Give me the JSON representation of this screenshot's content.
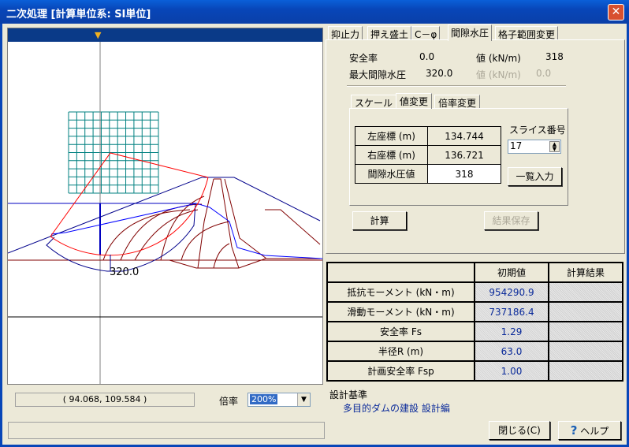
{
  "window": {
    "title": "二次処理 [計算単位系: SI単位]",
    "close_icon": "close-icon"
  },
  "canvas": {
    "slip_label": "320.0",
    "coords": "( 94.068, 109.584 )",
    "zoom_label": "倍率",
    "zoom_value": "200%"
  },
  "tabs": [
    "抑止力",
    "押え盛土",
    "C－φ",
    "間隙水圧",
    "格子範囲変更"
  ],
  "active_tab": 3,
  "summary": {
    "safety_label": "安全率",
    "safety_value": "0.0",
    "value_label": "値 (kN/m)",
    "value": "318",
    "max_label": "最大間隙水圧",
    "max_value": "320.0",
    "value2_label": "値 (kN/m)",
    "value2": "0.0"
  },
  "subtabs": [
    "スケール",
    "値変更",
    "倍率変更"
  ],
  "subgrid": [
    {
      "label": "左座標 (m)",
      "value": "134.744"
    },
    {
      "label": "右座標 (m)",
      "value": "136.721"
    },
    {
      "label": "間隙水圧値",
      "value": "318"
    }
  ],
  "slice": {
    "label": "スライス番号",
    "value": "17",
    "list_button": "一覧入力"
  },
  "buttons": {
    "calc": "計算",
    "save": "結果保存",
    "close": "閉じる(C)",
    "help": "ヘルプ"
  },
  "results": {
    "headers": [
      "",
      "初期値",
      "計算結果"
    ],
    "rows": [
      {
        "label": "抵抗モーメント (kN・m)",
        "initial": "954290.9",
        "result": ""
      },
      {
        "label": "滑動モーメント (kN・m)",
        "initial": "737186.4",
        "result": ""
      },
      {
        "label": "安全率 Fs",
        "initial": "1.29",
        "result": ""
      },
      {
        "label": "半径R (m)",
        "initial": "63.0",
        "result": ""
      },
      {
        "label": "計画安全率 Fsp",
        "initial": "1.00",
        "result": ""
      }
    ]
  },
  "standard": {
    "label": "設計基準",
    "value": "多目的ダムの建設 設計編"
  }
}
